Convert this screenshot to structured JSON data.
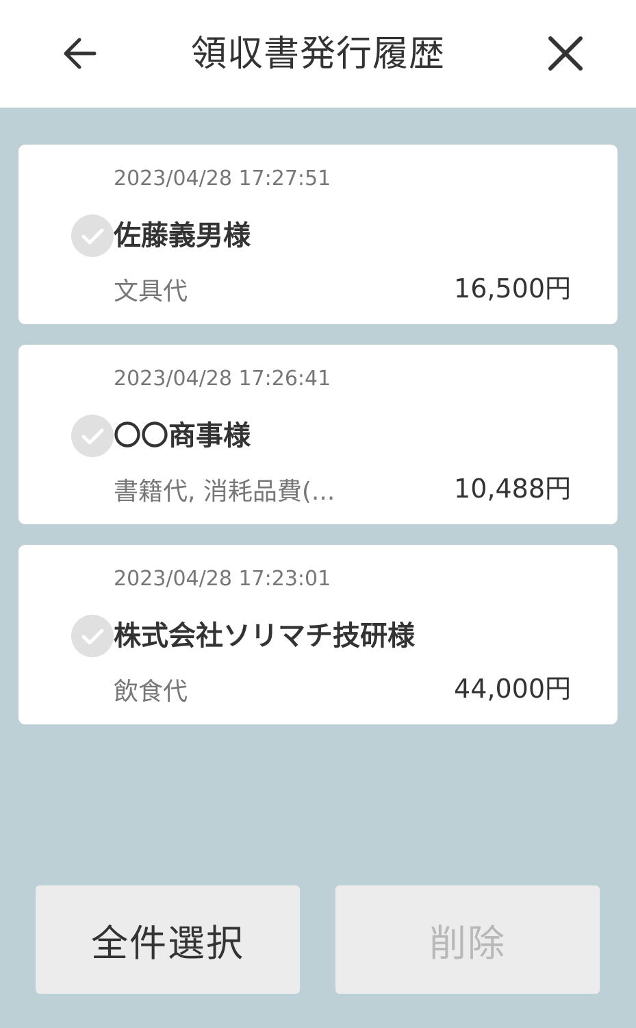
{
  "header": {
    "title": "領収書発行履歴",
    "back_icon": "arrow-left-icon",
    "close_icon": "close-icon"
  },
  "receipts": [
    {
      "datetime": "2023/04/28 17:27:51",
      "recipient": "佐藤義男様",
      "purpose": "文具代",
      "amount": "16,500円",
      "checked": false
    },
    {
      "datetime": "2023/04/28 17:26:41",
      "recipient": "〇〇商事様",
      "purpose": "書籍代, 消耗品費(...",
      "amount": "10,488円",
      "checked": false
    },
    {
      "datetime": "2023/04/28 17:23:01",
      "recipient": "株式会社ソリマチ技研様",
      "purpose": "飲食代",
      "amount": "44,000円",
      "checked": false
    }
  ],
  "footer": {
    "select_all_label": "全件選択",
    "delete_label": "削除",
    "delete_enabled": false
  },
  "colors": {
    "background": "#bdd0d5",
    "card": "#ffffff",
    "check_inactive": "#e0e0e0",
    "button": "#ececec",
    "disabled_text": "#b8b8b8"
  }
}
